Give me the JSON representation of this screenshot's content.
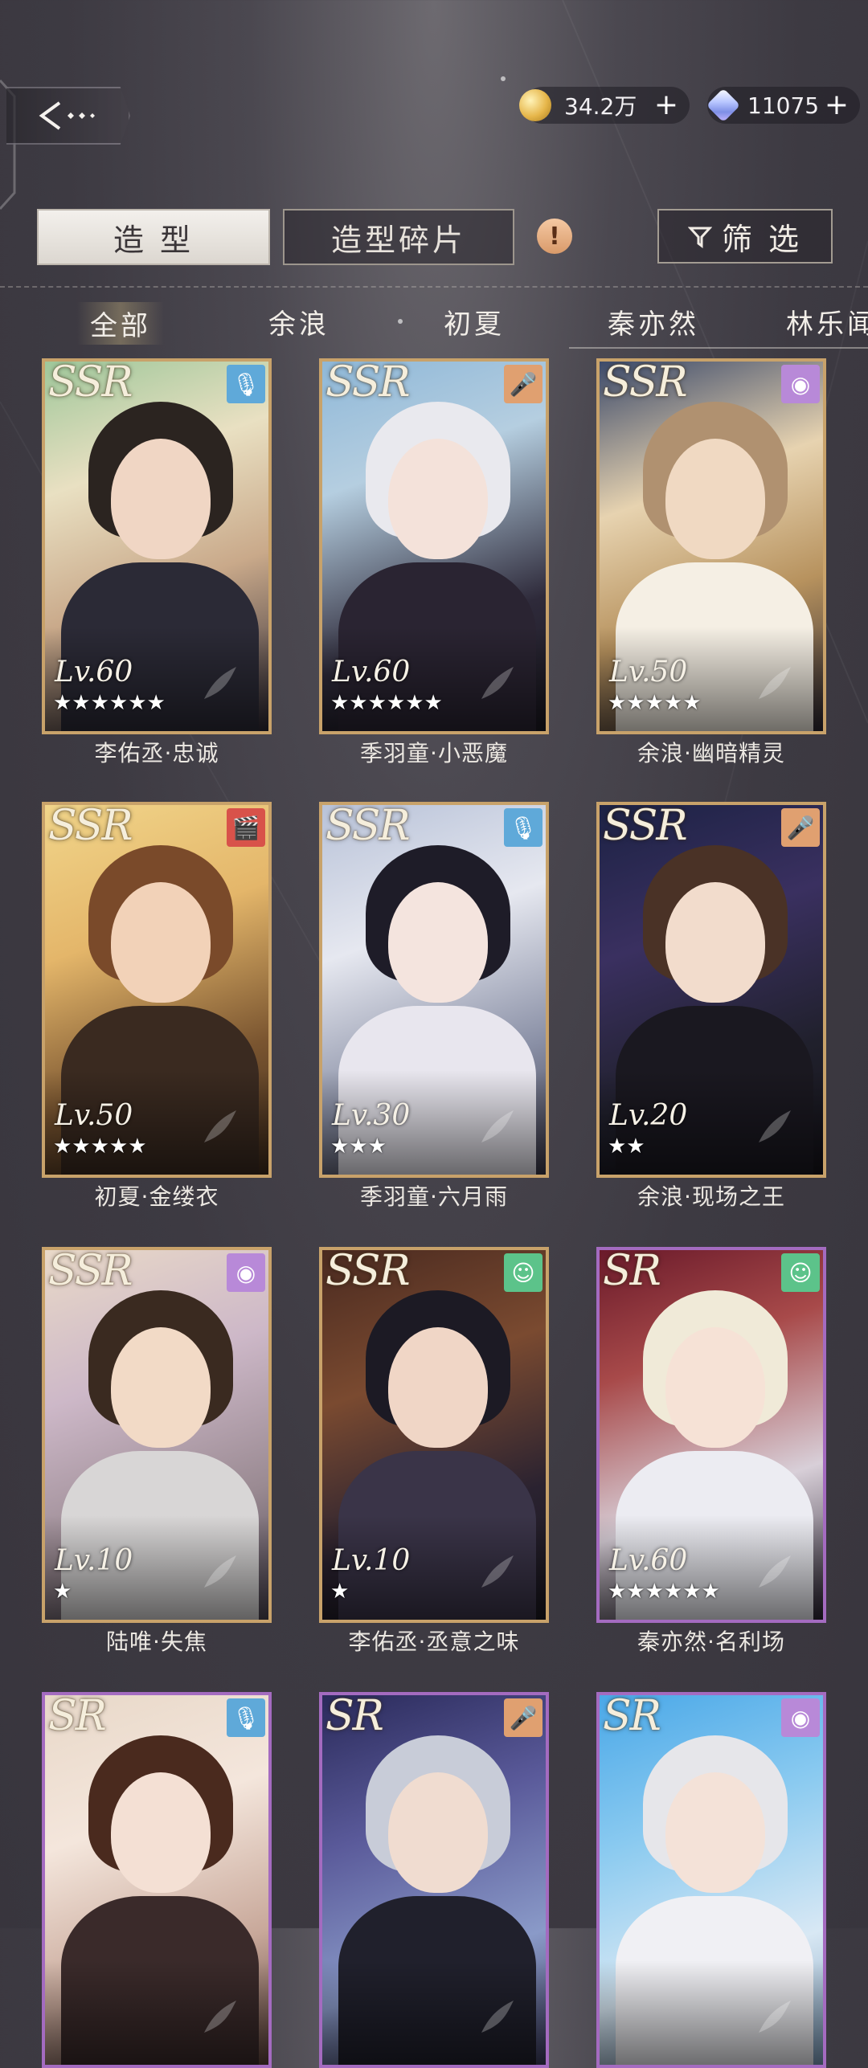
{
  "currency": {
    "gold": {
      "icon": "gold-coin-icon",
      "amount": "34.2万",
      "add": "+"
    },
    "gems": {
      "icon": "diamond-icon",
      "amount": "11075",
      "add": "+"
    }
  },
  "tabs": {
    "styling": "造 型",
    "fragments": "造型碎片",
    "alert": "!",
    "filter": "筛 选"
  },
  "characters": [
    "全部",
    "余浪",
    "初夏",
    "秦亦然",
    "林乐闻"
  ],
  "cards": [
    {
      "rarity": "SSR",
      "level": "Lv.60",
      "stars": "★★★★★★",
      "name": "李佑丞·忠诚",
      "badge": "microphone-icon",
      "badge_color": "#5fa9d9"
    },
    {
      "rarity": "SSR",
      "level": "Lv.60",
      "stars": "★★★★★★",
      "name": "季羽童·小恶魔",
      "badge": "karaoke-mic-icon",
      "badge_color": "#e0a070"
    },
    {
      "rarity": "SSR",
      "level": "Lv.50",
      "stars": "★★★★★",
      "name": "余浪·幽暗精灵",
      "badge": "lens-icon",
      "badge_color": "#b889d8"
    },
    {
      "rarity": "SSR",
      "level": "Lv.50",
      "stars": "★★★★★",
      "name": "初夏·金缕衣",
      "badge": "clapperboard-icon",
      "badge_color": "#d8524a"
    },
    {
      "rarity": "SSR",
      "level": "Lv.30",
      "stars": "★★★",
      "name": "季羽童·六月雨",
      "badge": "microphone-icon",
      "badge_color": "#5fa9d9"
    },
    {
      "rarity": "SSR",
      "level": "Lv.20",
      "stars": "★★",
      "name": "余浪·现场之王",
      "badge": "karaoke-mic-icon",
      "badge_color": "#e0a070"
    },
    {
      "rarity": "SSR",
      "level": "Lv.10",
      "stars": "★",
      "name": "陆唯·失焦",
      "badge": "lens-icon",
      "badge_color": "#b889d8"
    },
    {
      "rarity": "SSR",
      "level": "Lv.10",
      "stars": "★",
      "name": "李佑丞·丞意之味",
      "badge": "smile-icon",
      "badge_color": "#5cc38a"
    },
    {
      "rarity": "SR",
      "level": "Lv.60",
      "stars": "★★★★★★",
      "name": "秦亦然·名利场",
      "badge": "smile-icon",
      "badge_color": "#5cc38a"
    },
    {
      "rarity": "SR",
      "level": "",
      "stars": "",
      "name": "",
      "badge": "microphone-icon",
      "badge_color": "#5fa9d9"
    },
    {
      "rarity": "SR",
      "level": "",
      "stars": "",
      "name": "",
      "badge": "karaoke-mic-icon",
      "badge_color": "#e0a070"
    },
    {
      "rarity": "SR",
      "level": "",
      "stars": "",
      "name": "",
      "badge": "lens-icon",
      "badge_color": "#b889d8"
    }
  ]
}
